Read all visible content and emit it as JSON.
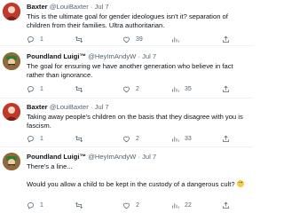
{
  "tweets": [
    {
      "name": "Baxter",
      "handle": "@LouiBaxter",
      "date": "Jul 7",
      "lines": [
        "This is the ultimate goal for gender ideologues isn't it? separation of",
        "children from their families. Ultra authoritarian."
      ],
      "replies": "1",
      "retweets": "",
      "likes": "39",
      "views": ""
    },
    {
      "name": "Poundland Luigi™",
      "handle": "@HeyImAndyW",
      "date": "Jul 7",
      "lines": [
        "The goal for ensuring we have another generation who believe in fact",
        "rather than ignorance."
      ],
      "replies": "1",
      "retweets": "",
      "likes": "2",
      "views": "35"
    },
    {
      "name": "Baxter",
      "handle": "@LouiBaxter",
      "date": "Jul 7",
      "lines": [
        "Taking away people's children on the basis that they disagree with you is",
        "fascism."
      ],
      "replies": "1",
      "retweets": "",
      "likes": "2",
      "views": "33"
    },
    {
      "name": "Poundland Luigi™",
      "handle": "@HeyImAndyW",
      "date": "Jul 7",
      "lines": [
        "There's a line...",
        "",
        "Would you allow a child to be kept in the custody of a dangerous cult?"
      ],
      "replies": "1",
      "retweets": "",
      "likes": "2",
      "views": "22"
    }
  ],
  "separator": "·",
  "icons": {
    "reply": "reply-icon",
    "retweet": "retweet-icon",
    "like": "heart-icon",
    "views": "views-bar-chart-icon",
    "share": "share-icon",
    "emoji": "thinking-face-emoji"
  },
  "colors": {
    "text": "#0f1419",
    "secondary": "#536471",
    "baxter_avatar": "#c0392b",
    "luigi_avatar": "#8f6a3c"
  }
}
